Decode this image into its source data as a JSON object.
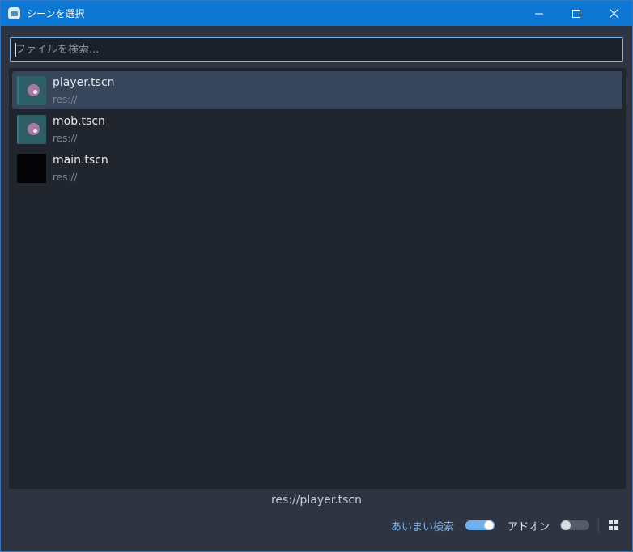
{
  "window": {
    "title": "シーンを選択",
    "controls": [
      "minimize-icon",
      "maximize-icon",
      "close-icon"
    ]
  },
  "search": {
    "placeholder": "ファイルを検索...",
    "value": ""
  },
  "files": [
    {
      "name": "player.tscn",
      "path": "res://",
      "selected": true,
      "thumbnail": "scene-preview"
    },
    {
      "name": "mob.tscn",
      "path": "res://",
      "selected": false,
      "thumbnail": "scene-preview"
    },
    {
      "name": "main.tscn",
      "path": "res://",
      "selected": false,
      "thumbnail": "black"
    }
  ],
  "status": {
    "selected_path": "res://player.tscn"
  },
  "footer": {
    "fuzzy_label": "あいまい検索",
    "fuzzy_enabled": true,
    "addon_label": "アドオン",
    "addon_enabled": false,
    "view_toggle_icon": "grid-view-icon"
  },
  "colors": {
    "titlebar": "#0d78d4",
    "accent": "#7eb6ef",
    "list_bg": "#21252e",
    "selected_row": "#37465a"
  }
}
